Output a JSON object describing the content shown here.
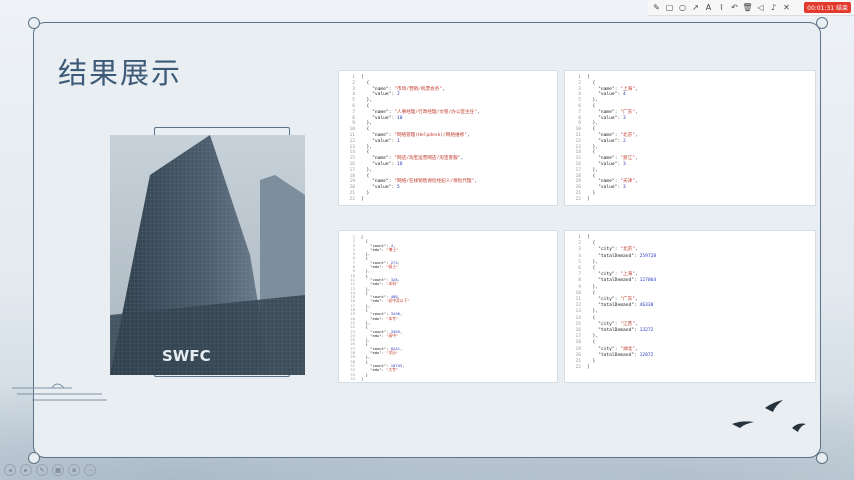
{
  "slide": {
    "title": "结果展示",
    "photo_sign": "SWFC"
  },
  "toolbar": {
    "timer": "00:01:31 结束",
    "icons": [
      "pen-icon",
      "rectangle-icon",
      "circle-icon",
      "arrow-icon",
      "text-icon",
      "highlighter-icon",
      "undo-icon",
      "trash-icon",
      "speaker-icon",
      "mic-icon",
      "close-icon"
    ]
  },
  "panel1": {
    "lines": [
      {
        "n": "1",
        "t": "["
      },
      {
        "n": "2",
        "t": "  {"
      },
      {
        "n": "3",
        "t": "    \"name\": \"市场/营销/机票会务\","
      },
      {
        "n": "4",
        "t": "    \"value\": 2"
      },
      {
        "n": "5",
        "t": "  },"
      },
      {
        "n": "6",
        "t": "  {"
      },
      {
        "n": "7",
        "t": "    \"name\": \"人事经理/行政经理/文管/办公室主任\","
      },
      {
        "n": "8",
        "t": "    \"value\": 10"
      },
      {
        "n": "9",
        "t": "  },"
      },
      {
        "n": "10",
        "t": "  {"
      },
      {
        "n": "11",
        "t": "    \"name\": \"网络管理(Helpdesk)/网络维修\","
      },
      {
        "n": "12",
        "t": "    \"value\": 1"
      },
      {
        "n": "13",
        "t": "  },"
      },
      {
        "n": "14",
        "t": "  {"
      },
      {
        "n": "15",
        "t": "    \"name\": \"网店/淘宝运营网店/淘宝客服\","
      },
      {
        "n": "16",
        "t": "    \"value\": 10"
      },
      {
        "n": "17",
        "t": "  },"
      },
      {
        "n": "18",
        "t": "  {"
      },
      {
        "n": "19",
        "t": "    \"name\": \"网络/在线销售保险经纪人/保险代理\","
      },
      {
        "n": "20",
        "t": "    \"value\": 5"
      },
      {
        "n": "21",
        "t": "  }"
      },
      {
        "n": "22",
        "t": "]"
      }
    ]
  },
  "panel2": {
    "lines": [
      {
        "n": "1",
        "t": "["
      },
      {
        "n": "2",
        "t": "  {"
      },
      {
        "n": "3",
        "t": "    \"name\": \"上海\","
      },
      {
        "n": "4",
        "t": "    \"value\": 4"
      },
      {
        "n": "5",
        "t": "  },"
      },
      {
        "n": "6",
        "t": "  {"
      },
      {
        "n": "7",
        "t": "    \"name\": \"广东\","
      },
      {
        "n": "8",
        "t": "    \"value\": 3"
      },
      {
        "n": "9",
        "t": "  },"
      },
      {
        "n": "10",
        "t": "  {"
      },
      {
        "n": "11",
        "t": "    \"name\": \"北京\","
      },
      {
        "n": "12",
        "t": "    \"value\": 2"
      },
      {
        "n": "13",
        "t": "  },"
      },
      {
        "n": "14",
        "t": "  {"
      },
      {
        "n": "15",
        "t": "    \"name\": \"浙江\","
      },
      {
        "n": "16",
        "t": "    \"value\": 3"
      },
      {
        "n": "17",
        "t": "  },"
      },
      {
        "n": "18",
        "t": "  {"
      },
      {
        "n": "19",
        "t": "    \"name\": \"天津\","
      },
      {
        "n": "20",
        "t": "    \"value\": 3"
      },
      {
        "n": "21",
        "t": "  }"
      },
      {
        "n": "22",
        "t": "]"
      }
    ]
  },
  "panel3": {
    "lines": [
      {
        "n": "1",
        "t": "["
      },
      {
        "n": "2",
        "t": "  {"
      },
      {
        "n": "3",
        "t": "    \"count\": 4,"
      },
      {
        "n": "4",
        "t": "    \"edu\": \"博士\""
      },
      {
        "n": "5",
        "t": "  },"
      },
      {
        "n": "6",
        "t": "  {"
      },
      {
        "n": "7",
        "t": "    \"count\": 273,"
      },
      {
        "n": "8",
        "t": "    \"edu\": \"硕士\""
      },
      {
        "n": "9",
        "t": "  },"
      },
      {
        "n": "10",
        "t": "  {"
      },
      {
        "n": "11",
        "t": "    \"count\": 328,"
      },
      {
        "n": "12",
        "t": "    \"edu\": \"本科\""
      },
      {
        "n": "13",
        "t": "  },"
      },
      {
        "n": "14",
        "t": "  {"
      },
      {
        "n": "15",
        "t": "    \"count\": 408,"
      },
      {
        "n": "16",
        "t": "    \"edu\": \"初中及以下\""
      },
      {
        "n": "17",
        "t": "  },"
      },
      {
        "n": "18",
        "t": "  {"
      },
      {
        "n": "19",
        "t": "    \"count\": 3436,"
      },
      {
        "n": "20",
        "t": "    \"edu\": \"本专\""
      },
      {
        "n": "21",
        "t": "  },"
      },
      {
        "n": "22",
        "t": "  {"
      },
      {
        "n": "23",
        "t": "    \"count\": 3365,"
      },
      {
        "n": "24",
        "t": "    \"edu\": \"高中\""
      },
      {
        "n": "25",
        "t": "  },"
      },
      {
        "n": "26",
        "t": "  {"
      },
      {
        "n": "27",
        "t": "    \"count\": 8241,"
      },
      {
        "n": "28",
        "t": "    \"edu\": \"学历\""
      },
      {
        "n": "29",
        "t": "  },"
      },
      {
        "n": "30",
        "t": "  {"
      },
      {
        "n": "31",
        "t": "    \"count\": 10743,"
      },
      {
        "n": "32",
        "t": "    \"edu\": \"大专\""
      },
      {
        "n": "33",
        "t": "  }"
      },
      {
        "n": "34",
        "t": "]"
      }
    ]
  },
  "panel4": {
    "lines": [
      {
        "n": "1",
        "t": "["
      },
      {
        "n": "2",
        "t": "  {"
      },
      {
        "n": "3",
        "t": "    \"city\": \"北京\","
      },
      {
        "n": "4",
        "t": "    \"totalDemand\": 259728"
      },
      {
        "n": "5",
        "t": "  },"
      },
      {
        "n": "6",
        "t": "  {"
      },
      {
        "n": "7",
        "t": "    \"city\": \"上海\","
      },
      {
        "n": "8",
        "t": "    \"totalDemand\": 127064"
      },
      {
        "n": "9",
        "t": "  },"
      },
      {
        "n": "10",
        "t": "  {"
      },
      {
        "n": "11",
        "t": "    \"city\": \"广东\","
      },
      {
        "n": "12",
        "t": "    \"totalDemand\": 46338"
      },
      {
        "n": "13",
        "t": "  },"
      },
      {
        "n": "14",
        "t": "  {"
      },
      {
        "n": "15",
        "t": "    \"city\": \"江苏\","
      },
      {
        "n": "16",
        "t": "    \"totalDemand\": 13272"
      },
      {
        "n": "17",
        "t": "  },"
      },
      {
        "n": "18",
        "t": "  {"
      },
      {
        "n": "19",
        "t": "    \"city\": \"湖北\","
      },
      {
        "n": "20",
        "t": "    \"totalDemand\": 12872"
      },
      {
        "n": "21",
        "t": "  }"
      },
      {
        "n": "22",
        "t": "]"
      }
    ]
  }
}
